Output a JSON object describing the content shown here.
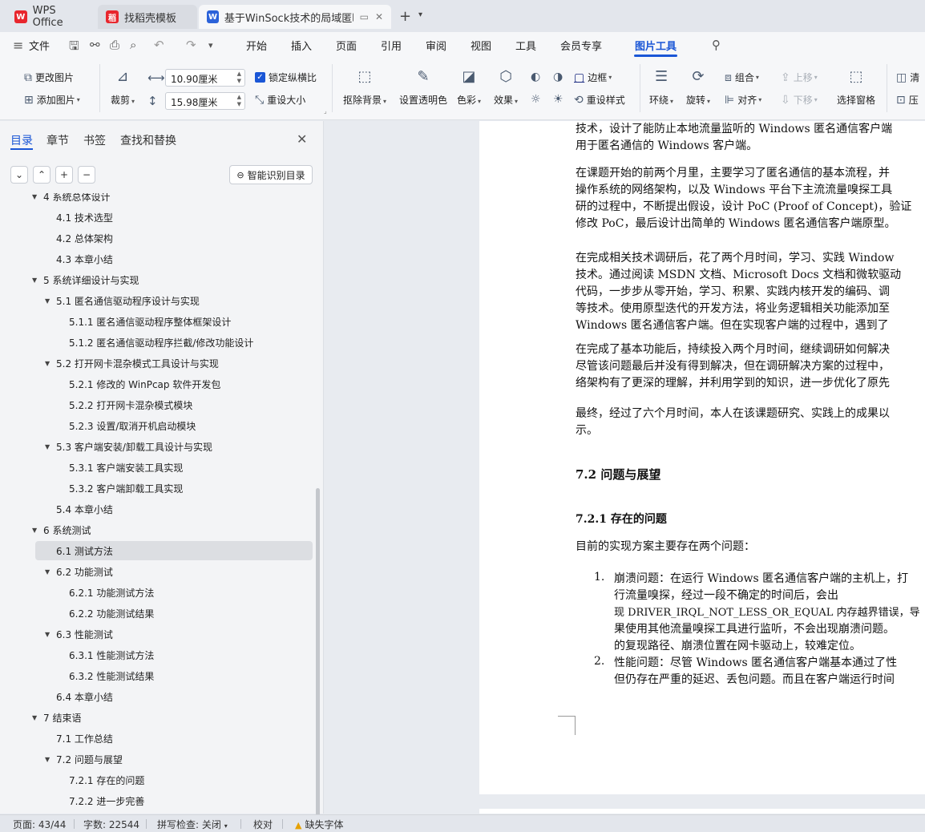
{
  "tabs": [
    {
      "label": "WPS Office",
      "icon": "wps-logo-icon",
      "color": "#e8262d"
    },
    {
      "label": "找稻壳模板",
      "icon": "docer-icon",
      "color": "#e8262d"
    },
    {
      "label": "基于WinSock技术的局域匿旺",
      "icon": "word-doc-icon",
      "color": "#2b62d9"
    }
  ],
  "menu": {
    "file": "文件",
    "items": [
      "开始",
      "插入",
      "页面",
      "引用",
      "审阅",
      "视图",
      "工具",
      "会员专享",
      "图片工具"
    ],
    "active": "图片工具"
  },
  "ribbon": {
    "change_picture": "更改图片",
    "add_picture": "添加图片",
    "crop": "裁剪",
    "width_value": "10.90厘米",
    "height_value": "15.98厘米",
    "lock_ratio": "锁定纵横比",
    "reset_size": "重设大小",
    "remove_bg": "抠除背景",
    "set_transparent": "设置透明色",
    "color": "色彩",
    "effect": "效果",
    "border": "边框",
    "reset_style": "重设样式",
    "wrap": "环绕",
    "rotate": "旋转",
    "group": "组合",
    "align": "对齐",
    "bring_forward": "上移",
    "send_backward": "下移",
    "selection_pane": "选择窗格",
    "clear": "清",
    "compress": "压"
  },
  "panel": {
    "tabs": [
      "目录",
      "章节",
      "书签",
      "查找和替换"
    ],
    "smart_button": "智能识别目录",
    "toc": [
      {
        "level": 1,
        "text": "4  系统总体设计",
        "expanded": true
      },
      {
        "level": 2,
        "text": "4.1  技术选型"
      },
      {
        "level": 2,
        "text": "4.2  总体架构"
      },
      {
        "level": 2,
        "text": "4.3  本章小结"
      },
      {
        "level": 1,
        "text": "5  系统详细设计与实现",
        "expanded": true
      },
      {
        "level": 2,
        "text": "5.1  匿名通信驱动程序设计与实现",
        "expanded": true
      },
      {
        "level": 3,
        "text": "5.1.1  匿名通信驱动程序整体框架设计"
      },
      {
        "level": 3,
        "text": "5.1.2  匿名通信驱动程序拦截/修改功能设计"
      },
      {
        "level": 2,
        "text": "5.2  打开网卡混杂模式工具设计与实现",
        "expanded": true
      },
      {
        "level": 3,
        "text": "5.2.1  修改的  WinPcap  软件开发包"
      },
      {
        "level": 3,
        "text": "5.2.2  打开网卡混杂模式模块"
      },
      {
        "level": 3,
        "text": "5.2.3  设置/取消开机启动模块"
      },
      {
        "level": 2,
        "text": "5.3  客户端安装/卸载工具设计与实现",
        "expanded": true
      },
      {
        "level": 3,
        "text": "5.3.1  客户端安装工具实现"
      },
      {
        "level": 3,
        "text": "5.3.2  客户端卸载工具实现"
      },
      {
        "level": 2,
        "text": "5.4  本章小结"
      },
      {
        "level": 1,
        "text": "6  系统测试",
        "expanded": true
      },
      {
        "level": 2,
        "text": "6.1  测试方法",
        "selected": true
      },
      {
        "level": 2,
        "text": "6.2  功能测试",
        "expanded": true
      },
      {
        "level": 3,
        "text": "6.2.1  功能测试方法"
      },
      {
        "level": 3,
        "text": "6.2.2  功能测试结果"
      },
      {
        "level": 2,
        "text": "6.3  性能测试",
        "expanded": true
      },
      {
        "level": 3,
        "text": "6.3.1  性能测试方法"
      },
      {
        "level": 3,
        "text": "6.3.2  性能测试结果"
      },
      {
        "level": 2,
        "text": "6.4  本章小结"
      },
      {
        "level": 1,
        "text": "7  结束语",
        "expanded": true
      },
      {
        "level": 2,
        "text": "7.1  工作总结"
      },
      {
        "level": 2,
        "text": "7.2  问题与展望",
        "expanded": true
      },
      {
        "level": 3,
        "text": "7.2.1  存在的问题"
      },
      {
        "level": 3,
        "text": "7.2.2  进一步完善"
      }
    ]
  },
  "document": {
    "paragraphs": [
      [
        "技术，设计了能防止本地流量监听的  Windows  匿名通信客户端",
        "用于匿名通信的  Windows  客户端。"
      ],
      [
        "在课题开始的前两个月里，主要学习了匿名通信的基本流程，并",
        "操作系统的网络架构，以及  Windows  平台下主流流量嗅探工具",
        "研的过程中，不断提出假设，设计  PoC (Proof of Concept)，验证",
        "修改  PoC，最后设计出简单的  Windows  匿名通信客户端原型。"
      ],
      [
        "在完成相关技术调研后，花了两个月时间，学习、实践  Window",
        "技术。通过阅读  MSDN  文档、Microsoft Docs  文档和微软驱动",
        "代码，一步步从零开始，学习、积累、实践内核开发的编码、调",
        "等技术。使用原型迭代的开发方法，将业务逻辑相关功能添加至",
        "Windows  匿名通信客户端。但在实现客户端的过程中，遇到了"
      ],
      [
        "在完成了基本功能后，持续投入两个月时间，继续调研如何解决",
        "尽管该问题最后并没有得到解决，但在调研解决方案的过程中，",
        "络架构有了更深的理解，并利用学到的知识，进一步优化了原先"
      ],
      [
        "最终，经过了六个月时间，本人在该课题研究、实践上的成果以",
        "示。"
      ]
    ],
    "heading2": "7.2  问题与展望",
    "heading3": "7.2.1  存在的问题",
    "intro": "目前的实现方案主要存在两个问题：",
    "list": [
      {
        "num": "1.",
        "lines": [
          "崩溃问题：在运行  Windows  匿名通信客户端的主机上，打",
          "行流量嗅探，经过一段不确定的时间后，会出",
          "现 DRIVER_IRQL_NOT_LESS_OR_EQUAL 内存越界错误，导",
          "果使用其他流量嗅探工具进行监听，不会出现崩溃问题。",
          "的复现路径、崩溃位置在网卡驱动上，较难定位。"
        ]
      },
      {
        "num": "2.",
        "lines": [
          "性能问题：尽管  Windows  匿名通信客户端基本通过了性",
          "但仍存在严重的延迟、丢包问题。而且在客户端运行时间"
        ]
      }
    ]
  },
  "status": {
    "page": "页面: 43/44",
    "words": "字数: 22544",
    "spellcheck": "拼写检查: 关闭",
    "proof": "校对",
    "missing_font": "缺失字体"
  }
}
